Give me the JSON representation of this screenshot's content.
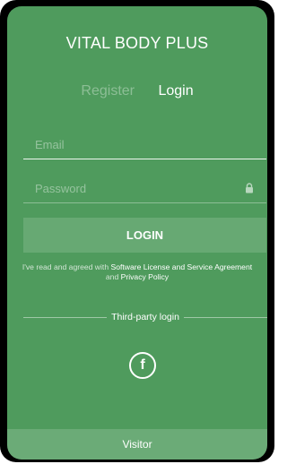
{
  "app": {
    "title": "VITAL BODY PLUS"
  },
  "tabs": [
    {
      "label": "Register",
      "active": false
    },
    {
      "label": "Login",
      "active": true
    }
  ],
  "form": {
    "email_placeholder": "Email",
    "email_value": "",
    "password_placeholder": "Password",
    "password_value": "",
    "login_label": "LOGIN"
  },
  "agreement": {
    "prefix": "I've read and agreed with ",
    "license_link": "Software License and Service Agreement",
    "conjunction": " and ",
    "privacy_link": "Privacy Policy"
  },
  "third_party": {
    "label": "Third-party login",
    "facebook_icon": "facebook-icon",
    "facebook_glyph": "f"
  },
  "footer": {
    "visitor_label": "Visitor"
  },
  "colors": {
    "background": "#4f9b5d",
    "text": "#ffffff",
    "frame": "#000000"
  }
}
